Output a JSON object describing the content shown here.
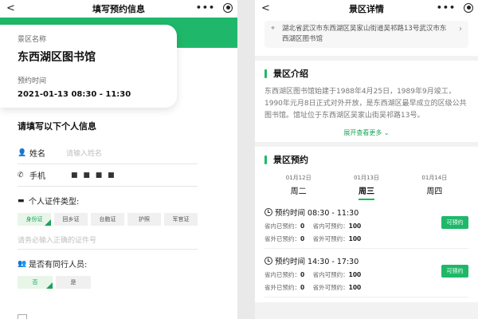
{
  "left": {
    "nav": {
      "back": "<",
      "title": "填写预约信息"
    },
    "card": {
      "venue_label": "景区名称",
      "venue_name": "东西湖区图书馆",
      "time_label": "预约时间",
      "time_value": "2021-01-13  08:30 - 11:30"
    },
    "form": {
      "title": "请填写以下个人信息",
      "name_label": "姓名",
      "name_placeholder": "请输入姓名",
      "phone_label": "手机",
      "phone_value": "■ ■ ■ ■",
      "id_type_label": "个人证件类型:",
      "id_types": [
        "身份证",
        "回乡证",
        "台胞证",
        "护照",
        "军官证"
      ],
      "id_placeholder": "请务必输入正确的证件号",
      "companion_label": "是否有同行人员:",
      "companion_options": [
        "否",
        "是"
      ]
    }
  },
  "right": {
    "nav": {
      "back": "<",
      "title": "景区详情"
    },
    "address": "湖北省武汉市东西湖区吴家山街道吴祁路13号武汉市东西湖区图书馆",
    "intro_title": "景区介绍",
    "intro_text": "东西湖区图书馆始建于1988年4月25日，1989年9月竣工，1990年元月8日正式对外开放，是东西湖区最早成立的区级公共图书馆。馆址位于东西湖区吴家山街吴祁路13号。",
    "more": "展开查看更多",
    "booking_title": "景区预约",
    "days": [
      {
        "date": "01月12日",
        "weekday": "周二"
      },
      {
        "date": "01月13日",
        "weekday": "周三"
      },
      {
        "date": "01月14日",
        "weekday": "周四"
      }
    ],
    "slots": [
      {
        "time": "预约时间 08:30 - 11:30",
        "in_booked_label": "省内已预约：",
        "in_booked": "0",
        "in_can_label": "省内可预约：",
        "in_can": "100",
        "out_booked_label": "省外已预约：",
        "out_booked": "0",
        "out_can_label": "省外可预约：",
        "out_can": "100",
        "button": "可预约"
      },
      {
        "time": "预约时间 14:30 - 17:30",
        "in_booked_label": "省内已预约：",
        "in_booked": "0",
        "in_can_label": "省内可预约：",
        "in_can": "100",
        "out_booked_label": "省外已预约：",
        "out_booked": "0",
        "out_can_label": "省外可预约：",
        "out_can": "100",
        "button": "可预约"
      }
    ]
  },
  "colors": {
    "accent": "#1fb86a"
  }
}
